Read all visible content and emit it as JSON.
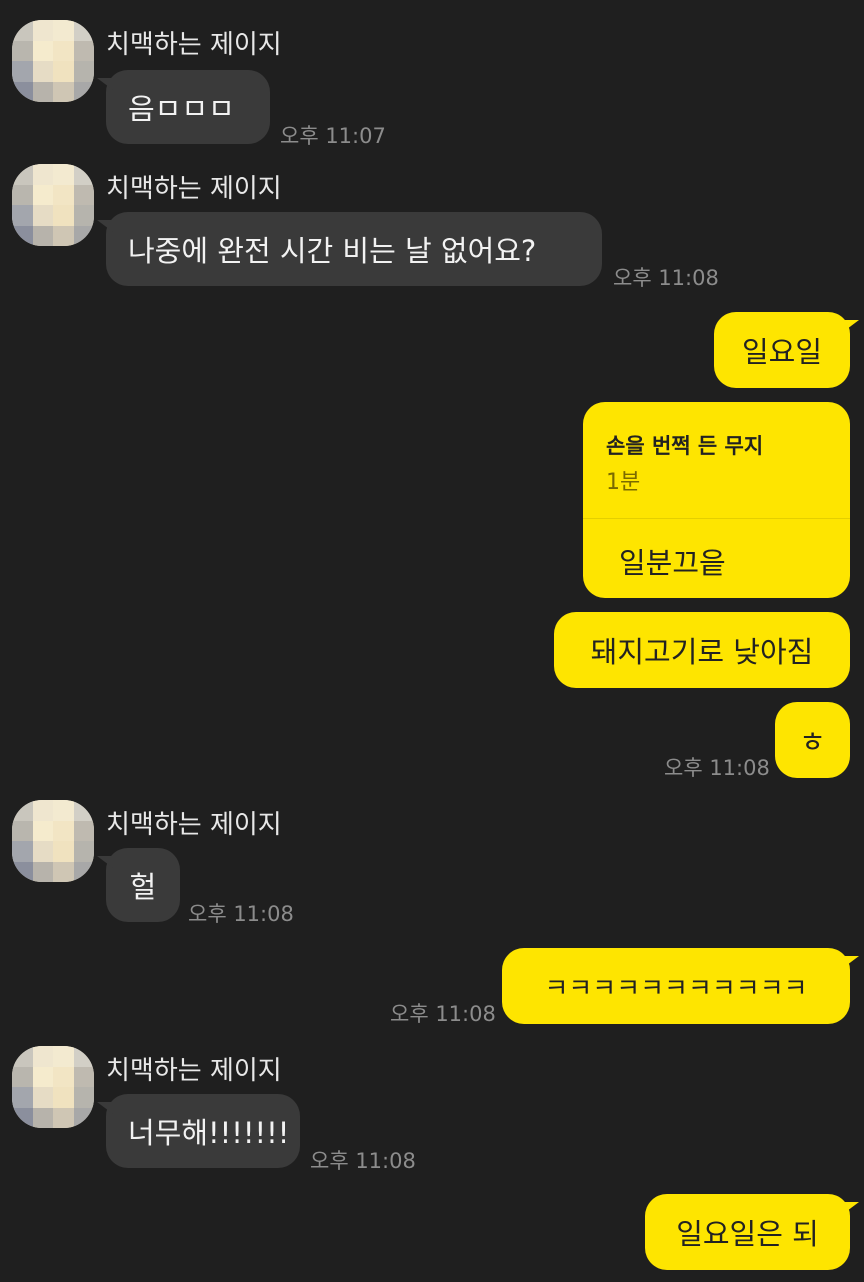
{
  "messages": {
    "m1": {
      "sender": "치맥하는 제이지",
      "text": "음ㅁㅁㅁ",
      "time": "오후 11:07"
    },
    "m2": {
      "sender": "치맥하는 제이지",
      "text": "나중에 완전 시간 비는 날 없어요?",
      "time": "오후 11:08"
    },
    "m3": {
      "text": "일요일"
    },
    "m4": {
      "reply_to_name": "손을 번쩍 든 무지",
      "reply_to_text": "1분",
      "text": "일분끄읕"
    },
    "m5": {
      "text": "돼지고기로 낮아짐"
    },
    "m6": {
      "text": "ㅎ",
      "time": "오후 11:08"
    },
    "m7": {
      "sender": "치맥하는 제이지",
      "text": "헐",
      "time": "오후 11:08"
    },
    "m8": {
      "text": "ㅋㅋㅋㅋㅋㅋㅋㅋㅋㅋㅋ",
      "time": "오후 11:08"
    },
    "m9": {
      "sender": "치맥하는 제이지",
      "text": "너무해!!!!!!!",
      "time": "오후 11:08"
    },
    "m10": {
      "text": "일요일은 되"
    }
  },
  "colors": {
    "background": "#1f1f1f",
    "incoming_bubble": "#3a3a3a",
    "outgoing_bubble": "#fee500",
    "time_text": "#8c8c8c"
  }
}
